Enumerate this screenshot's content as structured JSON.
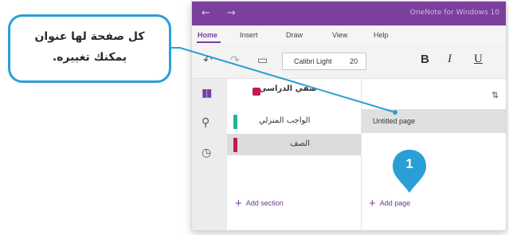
{
  "window": {
    "title": "OneNote for Windows 10",
    "back_glyph": "←",
    "forward_glyph": "→"
  },
  "menu": {
    "tabs": [
      {
        "label": "Home",
        "active": true
      },
      {
        "label": "Insert"
      },
      {
        "label": "Draw"
      },
      {
        "label": "View"
      },
      {
        "label": "Help"
      }
    ]
  },
  "toolbar": {
    "undo_glyph": "↶",
    "redo_glyph": "↷",
    "clipboard_glyph": "▭",
    "font_name": "Calibri Light",
    "font_size": "20",
    "bold": "B",
    "italic": "I",
    "underline": "U"
  },
  "rail": {
    "notebooks_glyph": "▮▮",
    "search_glyph": "⚲",
    "recent_glyph": "◷"
  },
  "notebook": {
    "name": "صفي الدراسي",
    "chevron": "⌄",
    "color": "#c2185b"
  },
  "sections": [
    {
      "label": "الواجب المنزلي",
      "color": "#1fb59a",
      "selected": false
    },
    {
      "label": "الصف",
      "color": "#c2185b",
      "selected": true
    }
  ],
  "actions": {
    "plus": "+",
    "add_section": "Add section",
    "add_page": "Add page"
  },
  "pages": [
    {
      "label": "Untitled page",
      "selected": true
    }
  ],
  "sort_glyph": "⇅",
  "callout": {
    "line1": "كل صفحة لها عنوان",
    "line2": "يمكنك تغييره."
  },
  "badge": {
    "number": "1",
    "color": "#2a9fd6"
  }
}
